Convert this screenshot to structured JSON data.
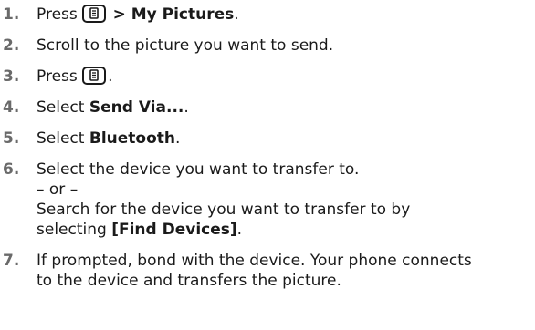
{
  "steps": [
    {
      "num": "1.",
      "before": "Press ",
      "icon": "menu-key-icon",
      "bold": "> My Pictures",
      "after": "."
    },
    {
      "num": "2.",
      "text": "Scroll to the picture you want to send."
    },
    {
      "num": "3.",
      "before": "Press ",
      "icon": "menu-key-icon",
      "after": "."
    },
    {
      "num": "4.",
      "before": "Select ",
      "bold": "Send Via...",
      "after": "."
    },
    {
      "num": "5.",
      "before": "Select ",
      "bold": "Bluetooth",
      "after": "."
    },
    {
      "num": "6.",
      "line1": "Select the device you want to transfer to.",
      "line2": "– or –",
      "line3": "Search for the device you want to transfer to by",
      "line4_before": "selecting ",
      "line4_bold": "[Find Devices]",
      "line4_after": "."
    },
    {
      "num": "7.",
      "line1": "If prompted, bond with the device. Your phone connects",
      "line2": "to the device and transfers the picture."
    }
  ]
}
